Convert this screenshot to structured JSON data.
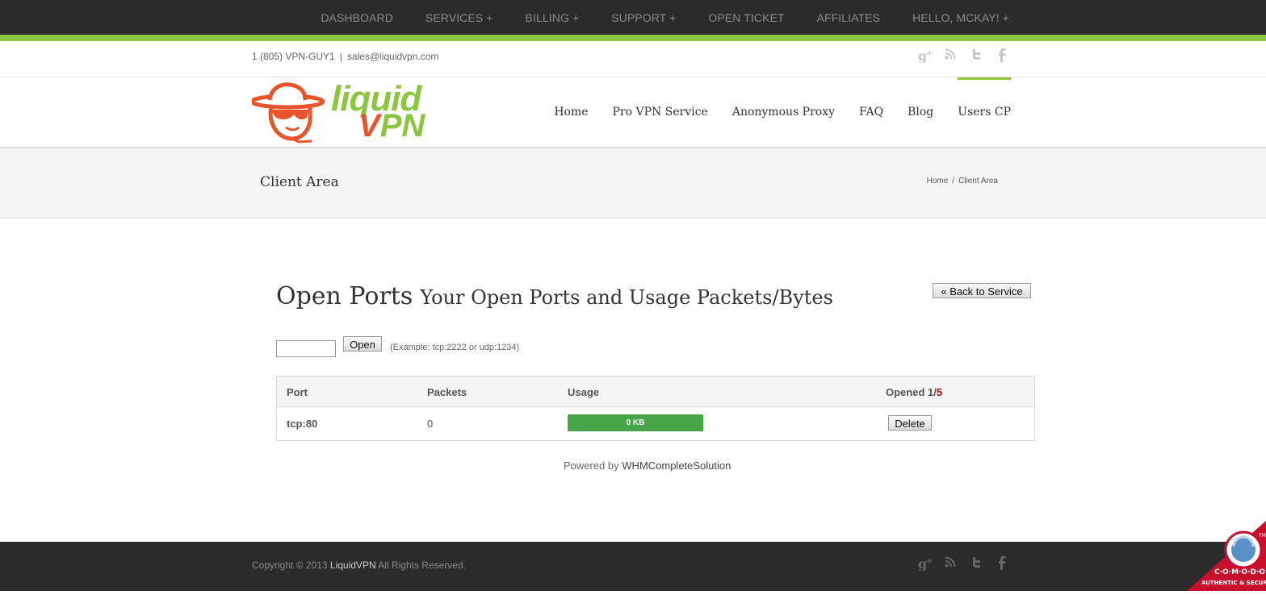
{
  "topnav": [
    "DASHBOARD",
    "SERVICES +",
    "BILLING +",
    "SUPPORT +",
    "OPEN TICKET",
    "AFFILIATES",
    "HELLO, MCKAY! +"
  ],
  "contact": {
    "phone": "1 (805) VPN-GUY1",
    "separator": "|",
    "email": "sales@liquidvpn.com"
  },
  "social_icons": [
    "google-plus-icon",
    "rss-icon",
    "twitter-icon",
    "facebook-icon"
  ],
  "logo": {
    "word1": "liquid",
    "word2_v": "V",
    "word2_rest": "PN"
  },
  "mainnav": [
    "Home",
    "Pro VPN Service",
    "Anonymous Proxy",
    "FAQ",
    "Blog",
    "Users CP"
  ],
  "band": {
    "title": "Client Area",
    "crumb_home": "Home",
    "crumb_sep": "/",
    "crumb_current": "Client Area"
  },
  "content": {
    "heading": "Open Ports",
    "subheading": "Your Open Ports and Usage Packets/Bytes",
    "back_button": "« Back to Service",
    "port_input_value": "",
    "open_button": "Open",
    "hint": "(Example: tcp:2222 or udp:1234)"
  },
  "table": {
    "headers": {
      "port": "Port",
      "packets": "Packets",
      "usage": "Usage",
      "opened_prefix": "Opened 1/",
      "opened_max": "5"
    },
    "rows": [
      {
        "port": "tcp:80",
        "packets": "0",
        "usage": "0 KB",
        "usage_fraction": 1.0,
        "action": "Delete"
      }
    ]
  },
  "powered": {
    "prefix": "Powered by ",
    "link": "WHMCompleteSolution"
  },
  "footer": {
    "copy_prefix": "Copyright © 2013 ",
    "brand": "LiquidVPN",
    "copy_suffix": " All Rights Reserved."
  },
  "comodo": {
    "brand": "C·O·M·O·D·O",
    "tagline": "AUTHENTIC & SECURE",
    "tm": "TM"
  },
  "colors": {
    "accent_green": "#8cc63f",
    "logo_orange": "#e8542b",
    "usage_green": "#46a546",
    "dark_bar": "#2b2b2b",
    "limit_red": "#b00000"
  }
}
